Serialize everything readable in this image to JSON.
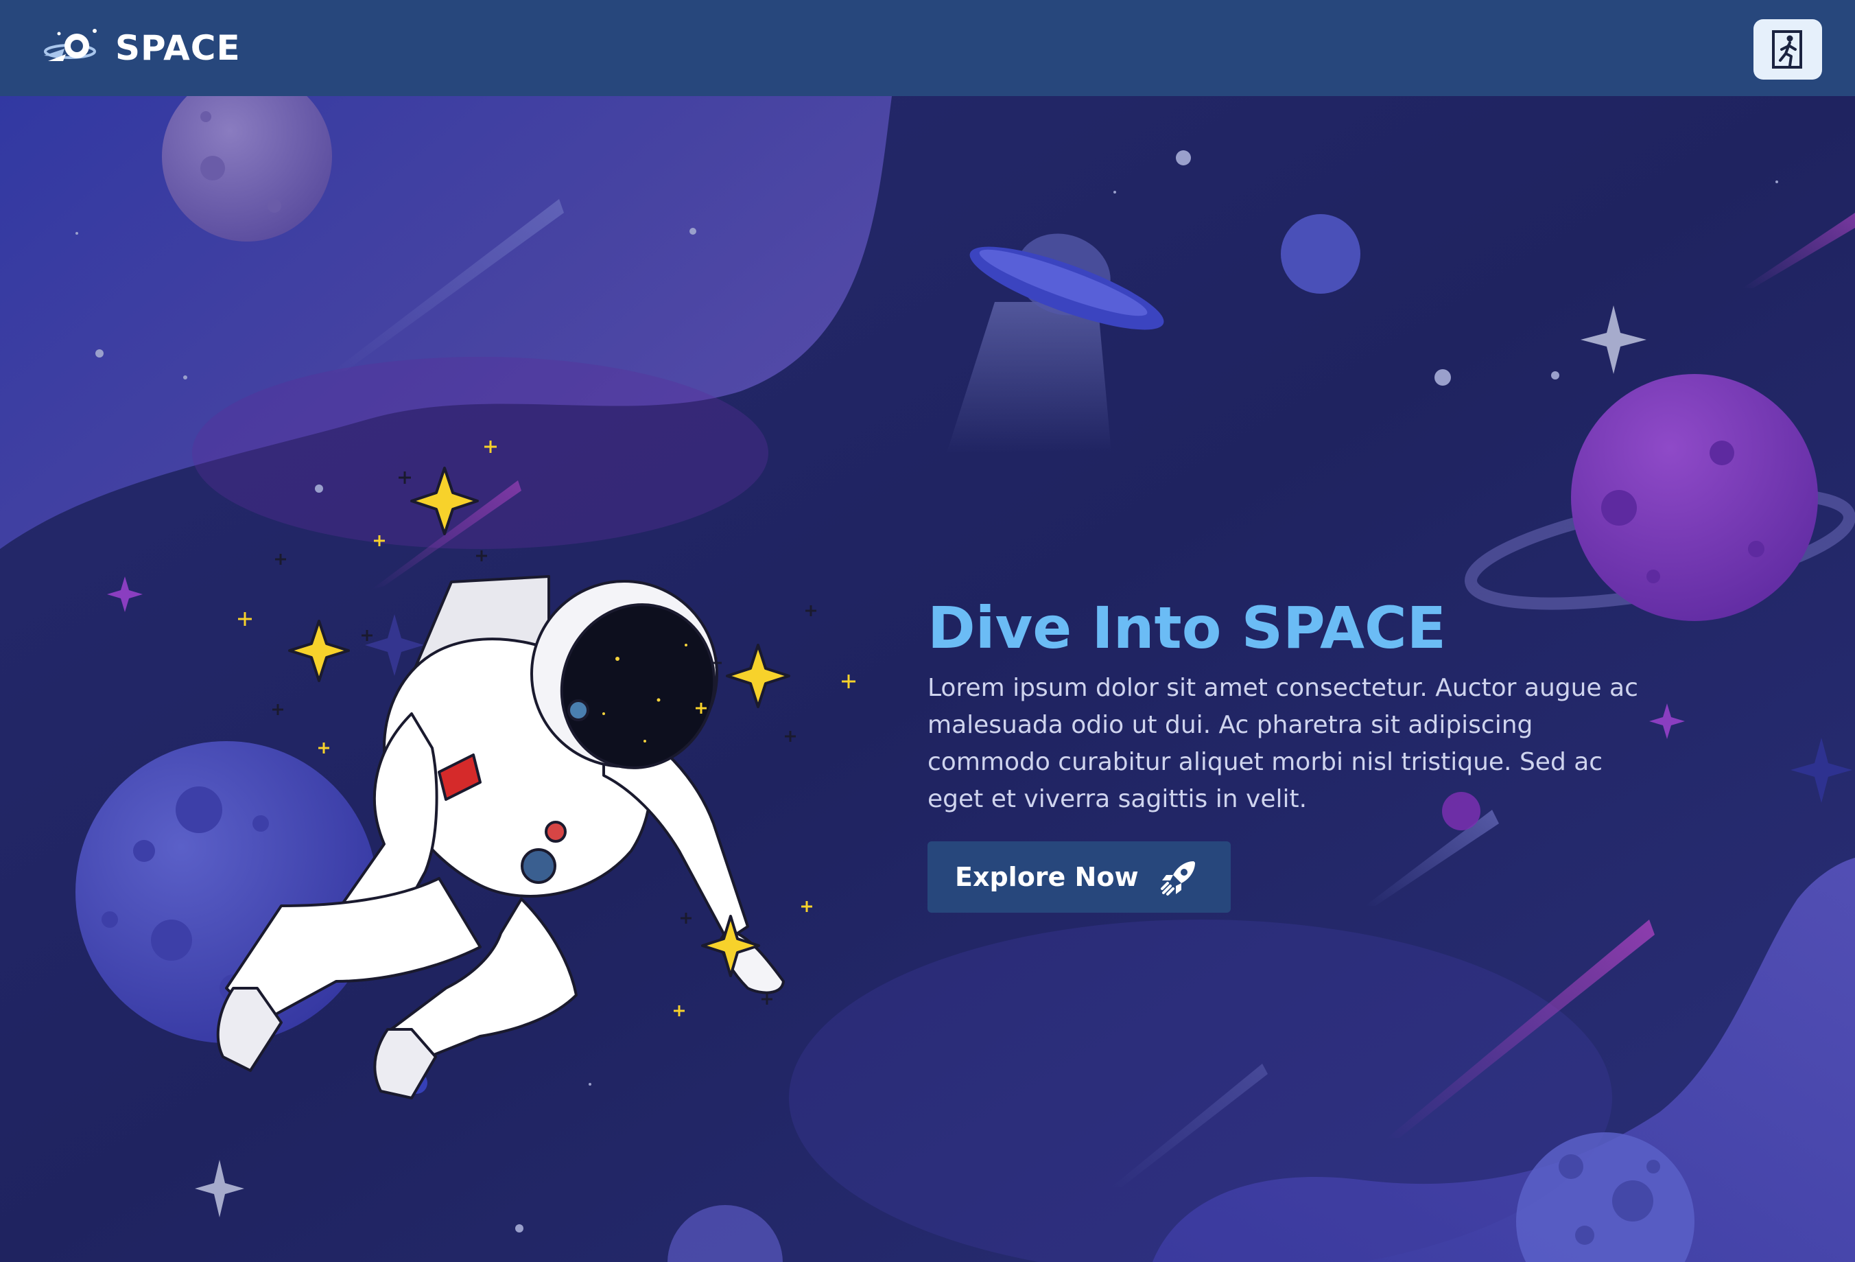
{
  "header": {
    "brand_name": "SPACE",
    "logo_icon": "rocket-planet-logo-icon",
    "exit_icon": "exit-door-icon"
  },
  "hero": {
    "title": "Dive Into SPACE",
    "description": "Lorem ipsum dolor sit amet consectetur. Auctor augue ac malesuada odio ut dui. Ac pharetra sit adipiscing commodo curabitur aliquet morbi nisl tristique. Sed ac eget et viverra sagittis in velit.",
    "cta_label": "Explore Now",
    "cta_icon": "rocket-icon"
  },
  "colors": {
    "navbar": "#27477c",
    "background": "#1f2360",
    "title": "#6bbcf5",
    "body_text": "#cfd4ee",
    "button": "#27477c"
  }
}
